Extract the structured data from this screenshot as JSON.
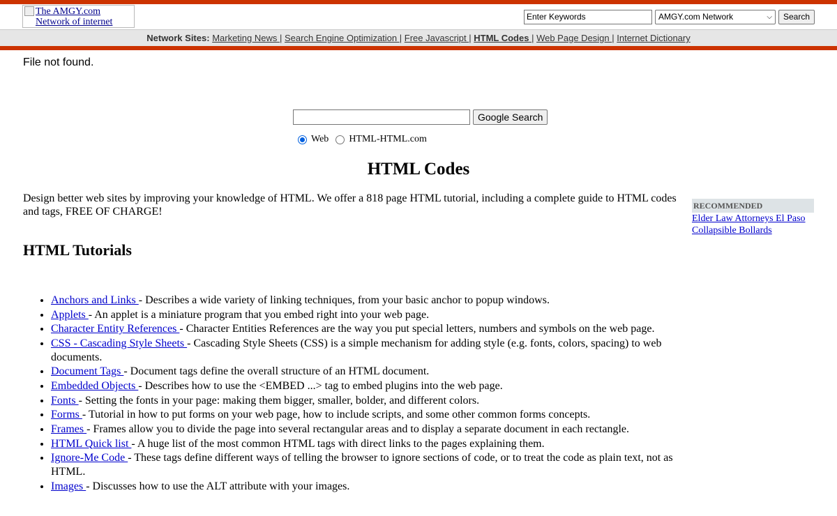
{
  "header": {
    "logo_alt_line1": "The AMGY.com",
    "logo_alt_line2": "Network of internet",
    "search_value": "Enter Keywords",
    "network_select": "AMGY.com Network",
    "search_button": "Search"
  },
  "navbar": {
    "label": "Network Sites:",
    "links": [
      {
        "label": "Marketing News ",
        "active": false
      },
      {
        "label": "Search Engine Optimization ",
        "active": false
      },
      {
        "label": "Free Javascript ",
        "active": false
      },
      {
        "label": "HTML Codes ",
        "active": true
      },
      {
        "label": "Web Page Design ",
        "active": false
      },
      {
        "label": "Internet Dictionary",
        "active": false
      }
    ]
  },
  "message": "File not found.",
  "google": {
    "input_value": "",
    "button": "Google Search",
    "radio_web": "Web",
    "radio_site": "HTML-HTML.com",
    "selected": "Web"
  },
  "page": {
    "title": "HTML Codes",
    "intro": "Design better web sites by improving your knowledge of HTML. We offer a 818 page HTML tutorial, including a complete guide to HTML codes and tags, FREE OF CHARGE!",
    "tutorials_heading": "HTML Tutorials"
  },
  "tutorials": [
    {
      "link": "Anchors and Links ",
      "desc": "- Describes a wide variety of linking techniques, from your basic anchor to popup windows."
    },
    {
      "link": "Applets ",
      "desc": "- An applet is a miniature program that you embed right into your web page."
    },
    {
      "link": "Character Entity References ",
      "desc": "- Character Entities References are the way you put special letters, numbers and symbols on the web page."
    },
    {
      "link": "CSS - Cascading Style Sheets ",
      "desc": "- Cascading Style Sheets (CSS) is a simple mechanism for adding style (e.g. fonts, colors, spacing) to web documents."
    },
    {
      "link": "Document Tags ",
      "desc": "- Document tags define the overall structure of an HTML document."
    },
    {
      "link": "Embedded Objects ",
      "desc": "- Describes how to use the <EMBED ...> tag to embed plugins into the web page."
    },
    {
      "link": "Fonts ",
      "desc": "- Setting the fonts in your page: making them bigger, smaller, bolder, and different colors."
    },
    {
      "link": "Forms ",
      "desc": "- Tutorial in how to put forms on your web page, how to include scripts, and some other common forms concepts."
    },
    {
      "link": "Frames ",
      "desc": "- Frames allow you to divide the page into several rectangular areas and to display a separate document in each rectangle."
    },
    {
      "link": "HTML Quick list ",
      "desc": "- A huge list of the most common HTML tags with direct links to the pages explaining them."
    },
    {
      "link": "Ignore-Me Code ",
      "desc": "- These tags define different ways of telling the browser to ignore sections of code, or to treat the code as plain text, not as HTML."
    },
    {
      "link": "Images ",
      "desc": "- Discusses how to use the ALT attribute with your images."
    }
  ],
  "recommended": {
    "heading": "RECOMMENDED",
    "links": [
      "Elder Law Attorneys El Paso",
      "Collapsible Bollards"
    ]
  }
}
